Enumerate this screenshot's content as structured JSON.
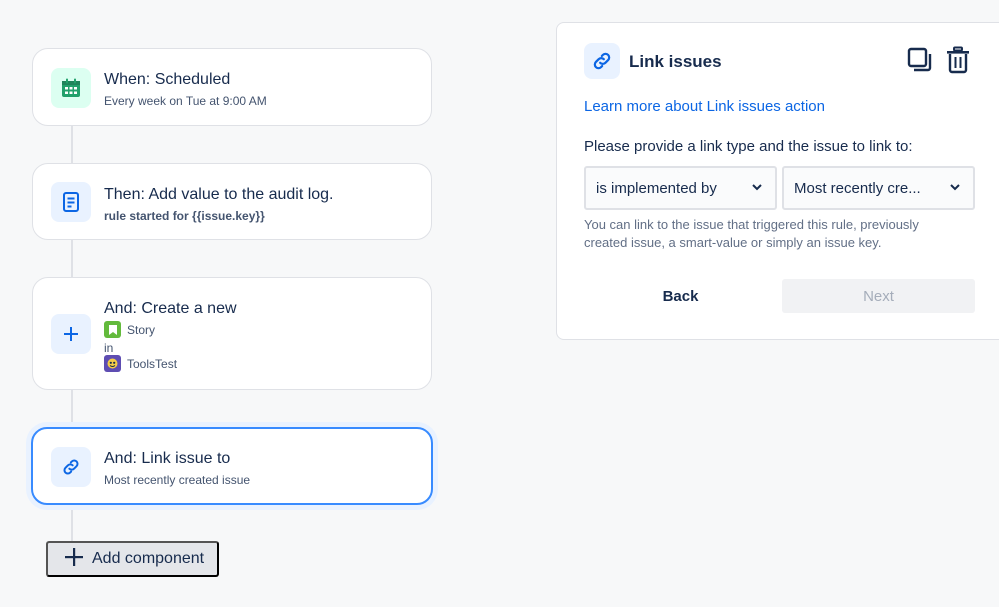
{
  "flow": {
    "components": [
      {
        "title": "When: Scheduled",
        "subtitle": "Every week on Tue at 9:00 AM",
        "icon": "calendar-icon"
      },
      {
        "title": "Then: Add value to the audit log.",
        "subtitle": "rule started for {{issue.key}}",
        "icon": "document-icon"
      },
      {
        "title": "And: Create a new",
        "issue_type": "Story",
        "in_label": "in",
        "project": "ToolsTest",
        "icon": "plus-icon"
      },
      {
        "title": "And: Link issue to",
        "subtitle": "Most recently created issue",
        "icon": "link-icon"
      }
    ],
    "add_component_label": "Add component"
  },
  "panel": {
    "title": "Link issues",
    "learn_more": "Learn more about Link issues action",
    "prompt": "Please provide a link type and the issue to link to:",
    "link_type_value": "is implemented by",
    "issue_value": "Most recently cre...",
    "help_text": "You can link to the issue that triggered this rule, previously created issue, a smart-value or simply an issue key.",
    "back_label": "Back",
    "next_label": "Next"
  },
  "colors": {
    "accent": "#0c66e4",
    "selected_border": "#388bff",
    "trigger_green": "#22a06b",
    "story_green": "#63ba3c"
  }
}
